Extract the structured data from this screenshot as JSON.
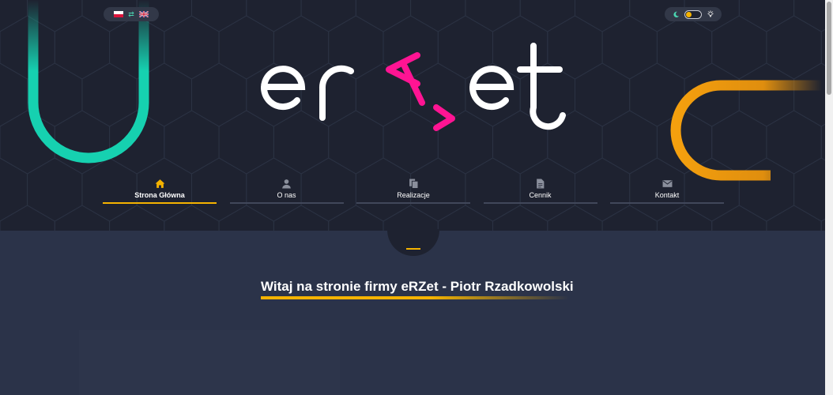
{
  "header": {
    "logo_text": "eRZet",
    "language_switch": {
      "languages": [
        "pl",
        "en"
      ],
      "current": "pl",
      "swap_icon": "swap-arrows-icon"
    },
    "theme_toggle": {
      "left_icon": "moon-icon",
      "right_icon": "sun-icon",
      "state": "dark",
      "knob_color": "#f5b300"
    }
  },
  "nav": {
    "items": [
      {
        "label": "Strona Główna",
        "icon": "home-icon",
        "active": true
      },
      {
        "label": "O nas",
        "icon": "user-icon",
        "active": false
      },
      {
        "label": "Realizacje",
        "icon": "files-icon",
        "active": false
      },
      {
        "label": "Cennik",
        "icon": "document-icon",
        "active": false
      },
      {
        "label": "Kontakt",
        "icon": "envelope-icon",
        "active": false
      }
    ]
  },
  "main": {
    "welcome_title": "Witaj na stronie firmy eRZet - Piotr Rzadkowolski"
  },
  "colors": {
    "accent": "#f5b300",
    "logo_accent": "#ff1493",
    "teal": "#16d1b0",
    "orange": "#f59a0a",
    "hero_bg": "#1e2230",
    "content_bg": "#2b3349"
  }
}
